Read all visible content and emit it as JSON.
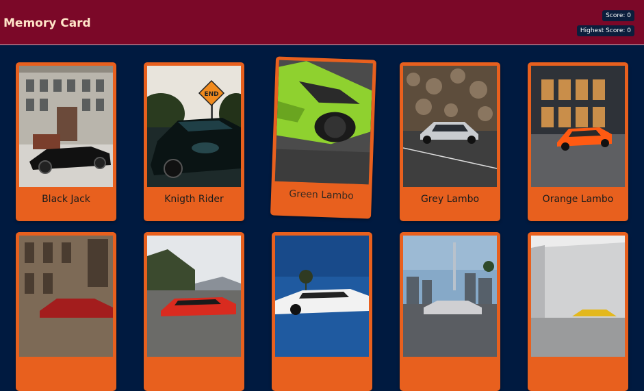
{
  "header": {
    "title": "Memory Card",
    "score_label": "Score: 0",
    "highest_label": "Highest Score: 0"
  },
  "colors": {
    "header_bg": "#7b0828",
    "page_bg": "#001a40",
    "card_bg": "#e8601e",
    "title_color": "#ffe4c8"
  },
  "cards": [
    {
      "name": "Black Jack"
    },
    {
      "name": "Knigth Rider"
    },
    {
      "name": "Green Lambo"
    },
    {
      "name": "Grey Lambo"
    },
    {
      "name": "Orange Lambo"
    },
    {
      "name": ""
    },
    {
      "name": ""
    },
    {
      "name": ""
    },
    {
      "name": ""
    },
    {
      "name": ""
    }
  ]
}
